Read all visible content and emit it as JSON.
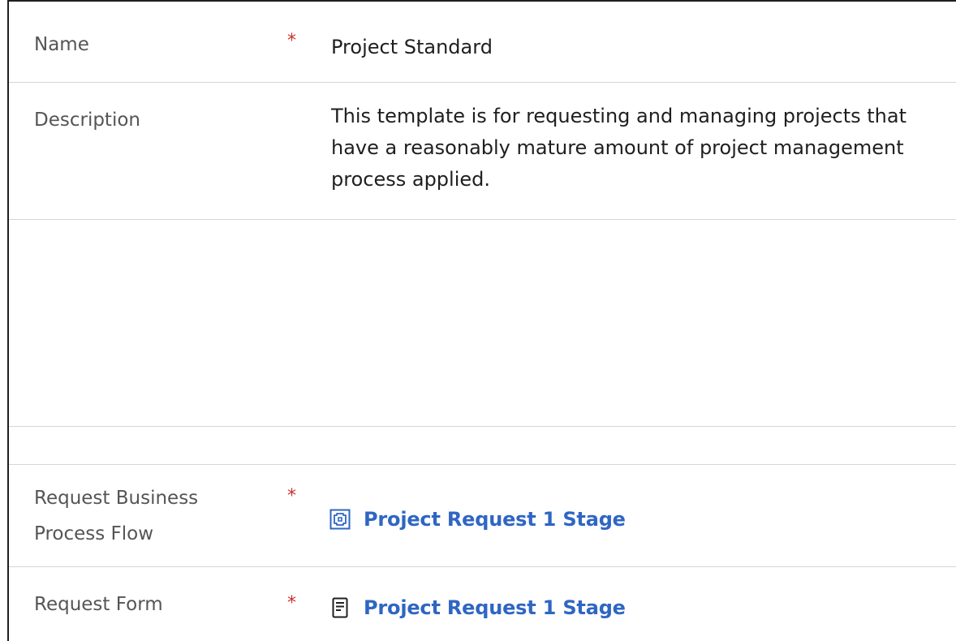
{
  "fields": {
    "name": {
      "label": "Name",
      "required": "*",
      "value": "Project Standard"
    },
    "description": {
      "label": "Description",
      "value": "This template is for requesting and managing projects that have a reasonably mature amount of project management process applied."
    },
    "request_business_process_flow": {
      "label_line1": "Request Business",
      "label_line2": "Process Flow",
      "required": "*",
      "value": "Project Request 1 Stage",
      "icon": "process-flow-icon"
    },
    "request_form": {
      "label": "Request Form",
      "required": "*",
      "value": "Project Request 1 Stage",
      "icon": "form-document-icon"
    }
  },
  "colors": {
    "link": "#2f66c3",
    "required": "#c8312a",
    "label": "#555555",
    "text": "#1f1f1f",
    "divider": "#d6d6d6"
  }
}
